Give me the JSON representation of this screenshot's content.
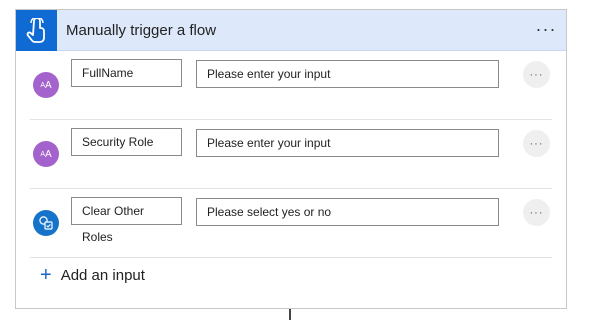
{
  "header": {
    "title": "Manually trigger a flow",
    "icon": "touch-hand-icon",
    "more_label": "···",
    "color": "#0f6ad4"
  },
  "inputs": [
    {
      "type_icon": "text-input-icon",
      "type_glyph": "AA",
      "name": "FullName",
      "placeholder": "Please enter your input",
      "more_label": "···"
    },
    {
      "type_icon": "text-input-icon",
      "type_glyph": "AA",
      "name": "Security Role",
      "placeholder": "Please enter your input",
      "more_label": "···"
    },
    {
      "type_icon": "yes-no-input-icon",
      "type_glyph": "",
      "name": "Clear Other Roles",
      "placeholder": "Please select yes or no",
      "more_label": "···"
    }
  ],
  "add_input": {
    "icon": "plus-icon",
    "label": "Add an input"
  }
}
